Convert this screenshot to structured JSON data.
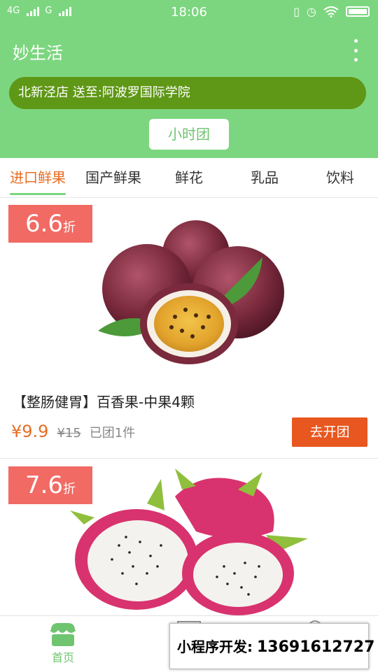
{
  "status_bar": {
    "network": "4G",
    "network2": "G",
    "time": "18:06"
  },
  "header": {
    "app_title": "妙生活",
    "store_line": "北新泾店 送至:阿波罗国际学院",
    "hour_button": "小时团"
  },
  "categories": [
    {
      "label": "进口鲜果",
      "active": true
    },
    {
      "label": "国产鲜果",
      "active": false
    },
    {
      "label": "鲜花",
      "active": false
    },
    {
      "label": "乳品",
      "active": false
    },
    {
      "label": "饮料",
      "active": false
    }
  ],
  "products": [
    {
      "discount": "6.6",
      "discount_unit": "折",
      "name": "【整肠健胃】百香果-中果4颗",
      "price": "¥9.9",
      "original_price": "¥15",
      "sold": "已团1件",
      "button": "去开团",
      "image": "passion-fruit-photo"
    },
    {
      "discount": "7.6",
      "discount_unit": "折",
      "image": "dragon-fruit-photo"
    }
  ],
  "tabbar": {
    "home_label": "首页",
    "home_icon": "shop-icon"
  },
  "ad": {
    "text": "小程序开发:",
    "phone": "13691612727"
  },
  "colors": {
    "primary_green": "#7cd67f",
    "store_bar": "#5f9716",
    "accent_orange": "#e86d22",
    "discount_red": "#f16a63",
    "button_orange": "#e8571f"
  }
}
